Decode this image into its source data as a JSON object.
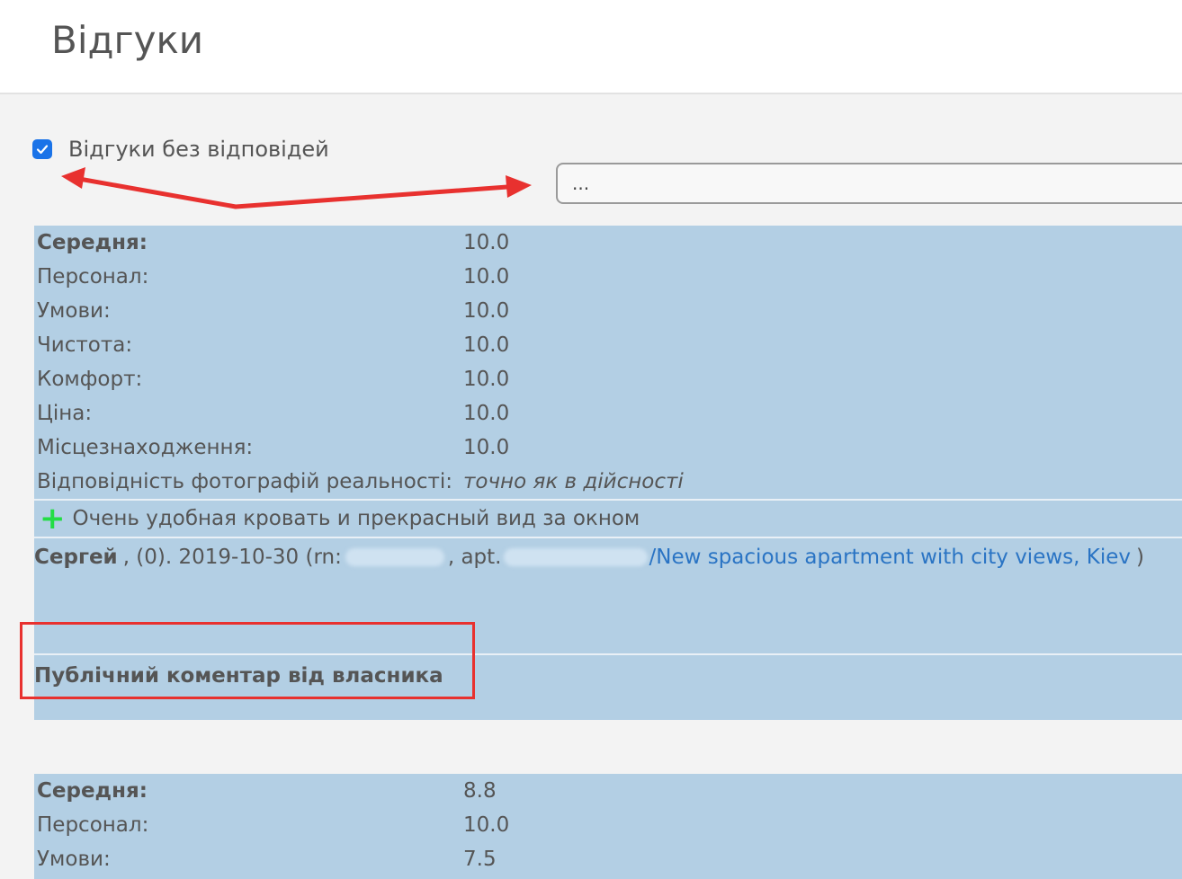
{
  "header": {
    "title": "Відгуки"
  },
  "filter": {
    "label": "Відгуки без відповідей",
    "checked": true
  },
  "search": {
    "value": "..."
  },
  "colors": {
    "accent": "#1a73e8",
    "review_bg": "#b3cfe4",
    "annotation": "#e8312f",
    "plus": "#22dd44",
    "link": "#2a74c4"
  },
  "reviews": [
    {
      "ratings": [
        {
          "label": "Середня:",
          "value": "10.0"
        },
        {
          "label": "Персонал:",
          "value": "10.0"
        },
        {
          "label": "Умови:",
          "value": "10.0"
        },
        {
          "label": "Чистота:",
          "value": "10.0"
        },
        {
          "label": "Комфорт:",
          "value": "10.0"
        },
        {
          "label": "Ціна:",
          "value": "10.0"
        },
        {
          "label": "Місцезнаходження:",
          "value": "10.0"
        },
        {
          "label": "Відповідність фотографій реальності:",
          "value": "точно як в дійсності"
        }
      ],
      "positive_comment": "Очень удобная кровать и прекрасный вид за окном",
      "author": "Сергей",
      "meta_count": ", (0). 2019-10-30 (rn:",
      "meta_apt": ", apt.",
      "apt_link": "/New spacious apartment with city views, Kiev",
      "meta_close": ")",
      "owner_comment_title": "Публічний коментар від власника"
    },
    {
      "ratings": [
        {
          "label": "Середня:",
          "value": "8.8"
        },
        {
          "label": "Персонал:",
          "value": "10.0"
        },
        {
          "label": "Умови:",
          "value": "7.5"
        }
      ]
    }
  ]
}
